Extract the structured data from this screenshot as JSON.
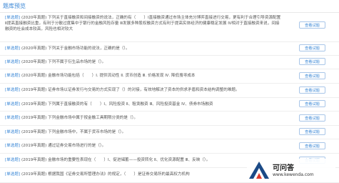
{
  "header": {
    "title": "题库预览"
  },
  "button_label": "查看试题",
  "questions": [
    {
      "tag": "[单选题]",
      "year": "(2020年真题)",
      "text": "下列关于直接融资和间接融资的说法，正确的有（　　）Ⅰ直接融资通过市场主体充分博弈直接进行交易，更有利于合理引导资源配置 Ⅱ提高直接融资比重，有利于分散过度集中于银行的金融风险存量 Ⅲ发展多种股权融资方式有利于提高实体经济的健康稳定发展 Ⅳ相对于直接融资来说，间接融资的社会成本较高，风险也相对较大"
    },
    {
      "tag": "[单选题]",
      "year": "(2020年真题)",
      "text": "下列关于金融市场功能的说法，正确的是（）。"
    },
    {
      "tag": "[单选题]",
      "year": "(2020年真题)",
      "text": "下列不属于衍生品市场的是（）。"
    },
    {
      "tag": "[单选题]",
      "year": "(2020年真题)",
      "text": "金融市场功能包括（　　）Ⅰ. 提供流动性 Ⅱ. 货币创造 Ⅲ. 价格发现 Ⅳ. 降低搜寻成本"
    },
    {
      "tag": "[单选题]",
      "year": "(2019年真题)",
      "text": "证券市场以证券发行与交易的方式实现了（）的对接，有效地解决了资本的供求矛盾和资本结构调整的难题。"
    },
    {
      "tag": "[单选题]",
      "year": "(2019年真题)",
      "text": "下列属于直接融资的有（　　）Ⅰ、风险投资 Ⅱ、租赁融资 Ⅲ、风险投资基金 Ⅳ、债券市场融资"
    },
    {
      "tag": "[单选题]",
      "year": "(2019年真题)",
      "text": "下列金融市场中属于按金融工具期限分类的是（）。"
    },
    {
      "tag": "[单选题]",
      "year": "(2019年真题)",
      "text": "下列金融市场中，不属于货币市场的是（）。"
    },
    {
      "tag": "[单选题]",
      "year": "(2019年真题)",
      "text": "通过证券交易市场进行的是（）。"
    },
    {
      "tag": "[单选题]",
      "year": "(2019年真题)",
      "text": "金融市场的重要性表现在（　　）Ⅰ、促进储蓄——投资转化 Ⅱ、优化资源配置 Ⅲ、反映（）。"
    },
    {
      "tag": "[单选题]",
      "year": "(2019年真题)",
      "text": "根据我国《证券交易所管理办法》的规定，（　　）是证券交易所的最高权力机构"
    }
  ],
  "watermark": {
    "name": "可问答",
    "url": "www.kewenda.com"
  }
}
